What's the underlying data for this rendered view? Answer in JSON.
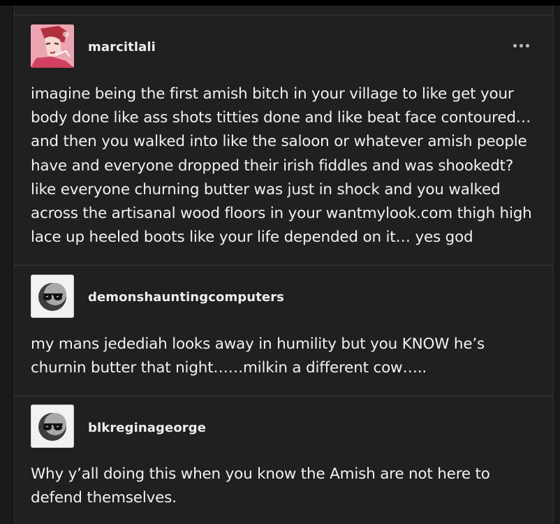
{
  "posts": [
    {
      "username": "marcitlali",
      "avatar": "anime-character-avatar",
      "text": "imagine being the first amish bitch in your village to like get your body done like ass shots titties done and like beat face contoured… and then you walked into like the saloon or whatever amish people have and everyone dropped their irish fiddles and was shookedt? like everyone churning butter was just in shock and you walked across the artisanal wood floors in your wantmylook.com thigh high lace up heeled boots like your life depended on it… yes god"
    },
    {
      "username": "demonshauntingcomputers",
      "avatar": "sunglasses-moon-icon",
      "text": "my mans jedediah looks away in humility but you KNOW he’s churnin butter that night……milkin a different cow….."
    },
    {
      "username": "blkreginageorge",
      "avatar": "sunglasses-moon-icon",
      "text": "Why y’all doing this when you know the Amish are not here to defend themselves."
    }
  ],
  "more_button": {
    "icon": "ellipsis-icon"
  },
  "colors": {
    "background": "#191919",
    "card": "#202020",
    "divider": "#3a3a3a",
    "text": "#f2f2f2"
  }
}
